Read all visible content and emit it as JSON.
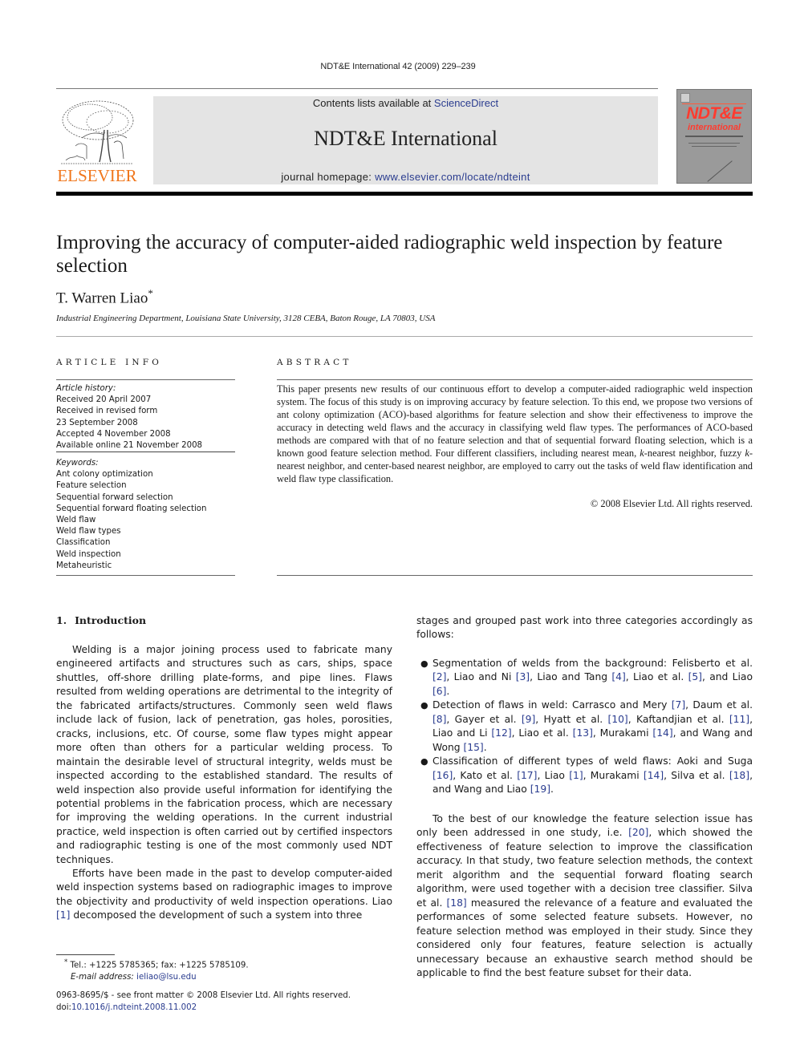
{
  "header": {
    "citation": "NDT&E International 42 (2009) 229–239",
    "contents_prefix": "Contents lists available at ",
    "contents_link": "ScienceDirect",
    "journal_title": "NDT&E International",
    "homepage_prefix": "journal homepage: ",
    "homepage_link": "www.elsevier.com/locate/ndteint",
    "publisher_logo_text": "ELSEVIER",
    "cover": {
      "title": "NDT&E",
      "subtitle": "international"
    },
    "colors": {
      "publisher_orange": "#f0761b",
      "link_blue": "#2a3c8f",
      "cover_red": "#ff3b2f",
      "masthead_gray": "#e4e4e4"
    }
  },
  "article": {
    "title": "Improving the accuracy of computer-aided radiographic weld inspection by feature selection",
    "author": "T. Warren Liao",
    "author_marker": "*",
    "affiliation": "Industrial Engineering Department, Louisiana State University, 3128 CEBA, Baton Rouge, LA 70803, USA"
  },
  "article_info": {
    "heading": "ARTICLE INFO",
    "history_label": "Article history:",
    "history": [
      "Received 20 April 2007",
      "Received in revised form",
      "23 September 2008",
      "Accepted 4 November 2008",
      "Available online 21 November 2008"
    ],
    "keywords_label": "Keywords:",
    "keywords": [
      "Ant colony optimization",
      "Feature selection",
      "Sequential forward selection",
      "Sequential forward floating selection",
      "Weld flaw",
      "Weld flaw types",
      "Classification",
      "Weld inspection",
      "Metaheuristic"
    ]
  },
  "abstract": {
    "heading": "ABSTRACT",
    "text_1": "This paper presents new results of our continuous effort to develop a computer-aided radiographic weld inspection system. The focus of this study is on improving accuracy by feature selection. To this end, we propose two versions of ant colony optimization (ACO)-based algorithms for feature selection and show their effectiveness to improve the accuracy in detecting weld flaws and the accuracy in classifying weld flaw types. The performances of ACO-based methods are compared with that of no feature selection and that of sequential forward floating selection, which is a known good feature selection method. Four different classifiers, including nearest mean, ",
    "k1": "k",
    "text_2": "-nearest neighbor, fuzzy ",
    "k2": "k",
    "text_3": "-nearest neighbor, and center-based nearest neighbor, are employed to carry out the tasks of weld flaw identification and weld flaw type classification.",
    "copyright": "© 2008 Elsevier Ltd. All rights reserved."
  },
  "intro": {
    "number": "1.",
    "heading": "Introduction",
    "p1": "Welding is a major joining process used to fabricate many engineered artifacts and structures such as cars, ships, space shuttles, off-shore drilling plate-forms, and pipe lines. Flaws resulted from welding operations are detrimental to the integrity of the fabricated artifacts/structures. Commonly seen weld flaws include lack of fusion, lack of penetration, gas holes, porosities, cracks, inclusions, etc. Of course, some flaw types might appear more often than others for a particular welding process. To maintain the desirable level of structural integrity, welds must be inspected according to the established standard. The results of weld inspection also provide useful information for identifying the potential problems in the fabrication process, which are necessary for improving the welding operations. In the current industrial practice, weld inspection is often carried out by certified inspectors and radiographic testing is one of the most commonly used NDT techniques.",
    "p2_a": "Efforts have been made in the past to develop computer-aided weld inspection systems based on radiographic images to improve the objectivity and productivity of weld inspection operations. Liao ",
    "p2_ref": "[1]",
    "p2_b": " decomposed the development of such a system into three",
    "right_intro": "stages and grouped past work into three categories accordingly as follows:",
    "bullets": [
      {
        "segments": [
          {
            "t": "Segmentation of welds from the background: Felisberto et al. "
          },
          {
            "ref": "[2]"
          },
          {
            "t": ", Liao and Ni "
          },
          {
            "ref": "[3]"
          },
          {
            "t": ", Liao and Tang "
          },
          {
            "ref": "[4]"
          },
          {
            "t": ", Liao et al. "
          },
          {
            "ref": "[5]"
          },
          {
            "t": ", and Liao "
          },
          {
            "ref": "[6]"
          },
          {
            "t": "."
          }
        ]
      },
      {
        "segments": [
          {
            "t": "Detection of flaws in weld: Carrasco and Mery "
          },
          {
            "ref": "[7]"
          },
          {
            "t": ", Daum et al. "
          },
          {
            "ref": "[8]"
          },
          {
            "t": ", Gayer et al. "
          },
          {
            "ref": "[9]"
          },
          {
            "t": ", Hyatt et al. "
          },
          {
            "ref": "[10]"
          },
          {
            "t": ", Kaftandjian et al. "
          },
          {
            "ref": "[11]"
          },
          {
            "t": ", Liao and Li "
          },
          {
            "ref": "[12]"
          },
          {
            "t": ", Liao et al. "
          },
          {
            "ref": "[13]"
          },
          {
            "t": ", Murakami "
          },
          {
            "ref": "[14]"
          },
          {
            "t": ", and Wang and Wong "
          },
          {
            "ref": "[15]"
          },
          {
            "t": "."
          }
        ]
      },
      {
        "segments": [
          {
            "t": "Classification of different types of weld flaws: Aoki and Suga "
          },
          {
            "ref": "[16]"
          },
          {
            "t": ", Kato et al. "
          },
          {
            "ref": "[17]"
          },
          {
            "t": ", Liao "
          },
          {
            "ref": "[1]"
          },
          {
            "t": ", Murakami "
          },
          {
            "ref": "[14]"
          },
          {
            "t": ", Silva et al. "
          },
          {
            "ref": "[18]"
          },
          {
            "t": ", and Wang and Liao "
          },
          {
            "ref": "[19]"
          },
          {
            "t": "."
          }
        ]
      }
    ],
    "p3_a": "To the best of our knowledge the feature selection issue has only been addressed in one study, i.e. ",
    "p3_ref1": "[20]",
    "p3_b": ", which showed the effectiveness of feature selection to improve the classification accuracy. In that study, two feature selection methods, the context merit algorithm and the sequential forward floating search algorithm, were used together with a decision tree classifier. Silva et al. ",
    "p3_ref2": "[18]",
    "p3_c": " measured the relevance of a feature and evaluated the performances of some selected feature subsets. However, no feature selection method was employed in their study. Since they considered only four features, feature selection is actually unnecessary because an exhaustive search method should be applicable to find the best feature subset for their data."
  },
  "footnote": {
    "marker": "*",
    "contact": " Tel.: +1225 5785365; fax: +1225 5785109.",
    "email_label": "E-mail address: ",
    "email": "ieliao@lsu.edu",
    "front_matter": "0963-8695/$ - see front matter © 2008 Elsevier Ltd. All rights reserved.",
    "doi_label": "doi:",
    "doi": "10.1016/j.ndteint.2008.11.002"
  }
}
